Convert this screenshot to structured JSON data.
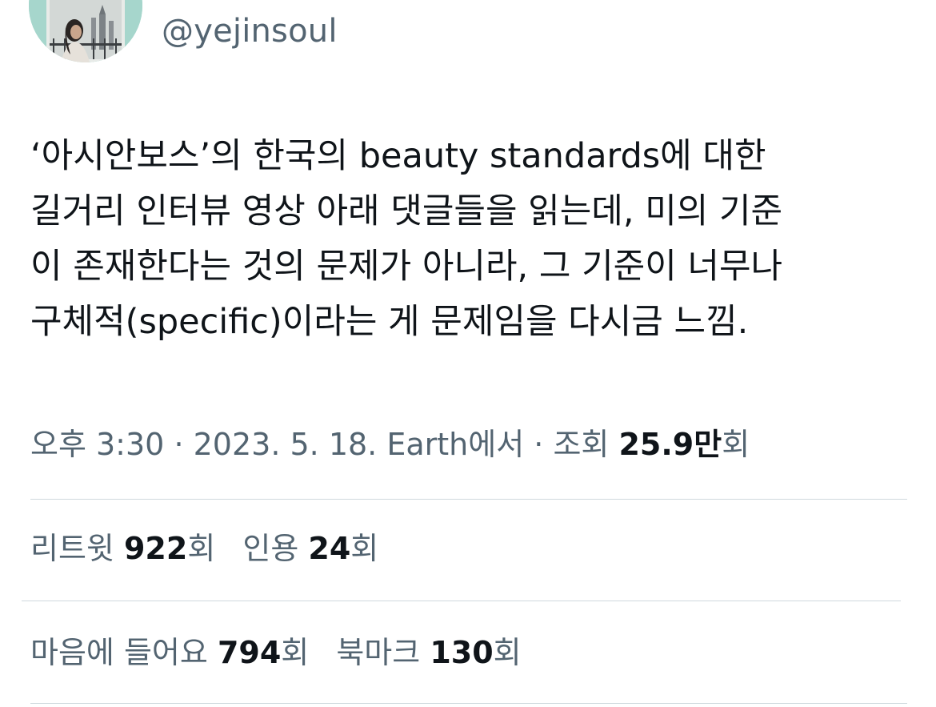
{
  "author": {
    "display_name": "",
    "handle": "@yejinsoul"
  },
  "tweet": {
    "lines": [
      "‘아시안보스’의 한국의 beauty standards에 대한",
      "길거리 인터뷰 영상 아래 댓글들을 읽는데, 미의 기준",
      "이 존재한다는 것의 문제가 아니라, 그 기준이 너무나",
      "구체적(specific)이라는 게 문제임을 다시금 느낌."
    ]
  },
  "meta": {
    "time": "오후 3:30",
    "separator": "·",
    "date": "2023. 5. 18.",
    "source": "Earth에서",
    "views_label": "조회",
    "views_value": "25.9만",
    "views_suffix": "회"
  },
  "stats": {
    "retweets": {
      "label": "리트윗",
      "value": "922",
      "suffix": "회"
    },
    "quotes": {
      "label": "인용",
      "value": "24",
      "suffix": "회"
    },
    "likes": {
      "label": "마음에 들어요",
      "value": "794",
      "suffix": "회"
    },
    "bookmarks": {
      "label": "북마크",
      "value": "130",
      "suffix": "회"
    }
  },
  "colors": {
    "text_primary": "#0f1419",
    "text_secondary": "#536471",
    "divider": "#cfd9de",
    "avatar_bg": "#9fd3c9"
  },
  "icons": {
    "avatar": "profile-photo-woman-standing"
  }
}
